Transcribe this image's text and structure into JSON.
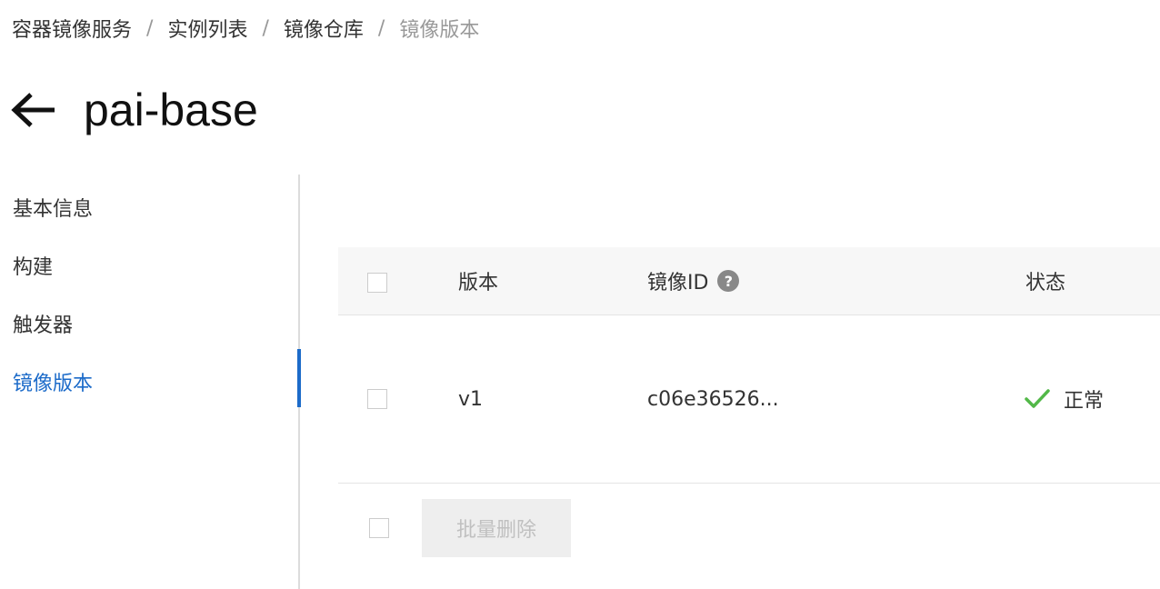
{
  "breadcrumb": {
    "items": [
      "容器镜像服务",
      "实例列表",
      "镜像仓库"
    ],
    "current": "镜像版本",
    "separator": "/"
  },
  "header": {
    "title": "pai-base",
    "back_icon": "arrow-left-icon"
  },
  "sidenav": {
    "items": [
      {
        "label": "基本信息",
        "active": false
      },
      {
        "label": "构建",
        "active": false
      },
      {
        "label": "触发器",
        "active": false
      },
      {
        "label": "镜像版本",
        "active": true
      }
    ]
  },
  "table": {
    "columns": {
      "version": "版本",
      "image_id": "镜像ID",
      "status": "状态"
    },
    "help_icon": "question-circle-icon",
    "help_glyph": "?",
    "rows": [
      {
        "version": "v1",
        "image_id": "c06e36526...",
        "status": "正常",
        "status_icon": "check-icon"
      }
    ]
  },
  "footer": {
    "batch_delete_label": "批量删除"
  },
  "colors": {
    "accent": "#1c6bc9",
    "success": "#52b848",
    "muted": "#999999",
    "header_bg": "#f7f7f7"
  }
}
